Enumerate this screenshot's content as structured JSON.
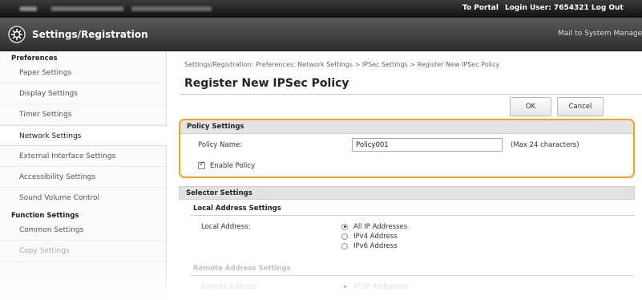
{
  "topbar": {
    "portal_link": "To Portal",
    "login_user": "Login User:  7654321  Log Out"
  },
  "header": {
    "title": "Settings/Registration",
    "mail_link": "Mail to System Manager",
    "logo_icon": "gear-icon"
  },
  "sidebar": {
    "preferences_heading": "Preferences",
    "preferences_items": [
      {
        "label": "Paper Settings"
      },
      {
        "label": "Display Settings"
      },
      {
        "label": "Timer Settings"
      },
      {
        "label": "Network Settings"
      },
      {
        "label": "External Interface Settings"
      },
      {
        "label": "Accessibility Settings"
      },
      {
        "label": "Sound Volume Control"
      }
    ],
    "function_heading": "Function Settings",
    "function_items": [
      {
        "label": "Common Settings"
      },
      {
        "label": "Copy Settings"
      }
    ],
    "active_item": "Network Settings"
  },
  "main": {
    "breadcrumb": "Settings/Registration: Preferences: Network Settings > IPSec Settings > Register New IPSec Policy",
    "page_title": "Register New IPSec Policy",
    "ok_label": "OK",
    "cancel_label": "Cancel"
  },
  "policy_settings": {
    "heading": "Policy Settings",
    "policy_name_label": "Policy Name:",
    "policy_name_value": "Policy001",
    "policy_name_hint": "(Max 24 characters)",
    "enable_policy_label": "Enable Policy",
    "enable_policy_checked": true,
    "highlight_color": "#f2a51c"
  },
  "selector_settings": {
    "heading": "Selector Settings",
    "local_heading": "Local Address Settings",
    "local_address_label": "Local Address:",
    "local_options": [
      "All IP Addresses",
      "IPv4 Address",
      "IPv6 Address"
    ],
    "local_selected": "All IP Addresses",
    "remote_heading": "Remote Address Settings",
    "remote_address_label": "Remote Address:",
    "remote_options": [
      "All IP Addresses"
    ]
  }
}
